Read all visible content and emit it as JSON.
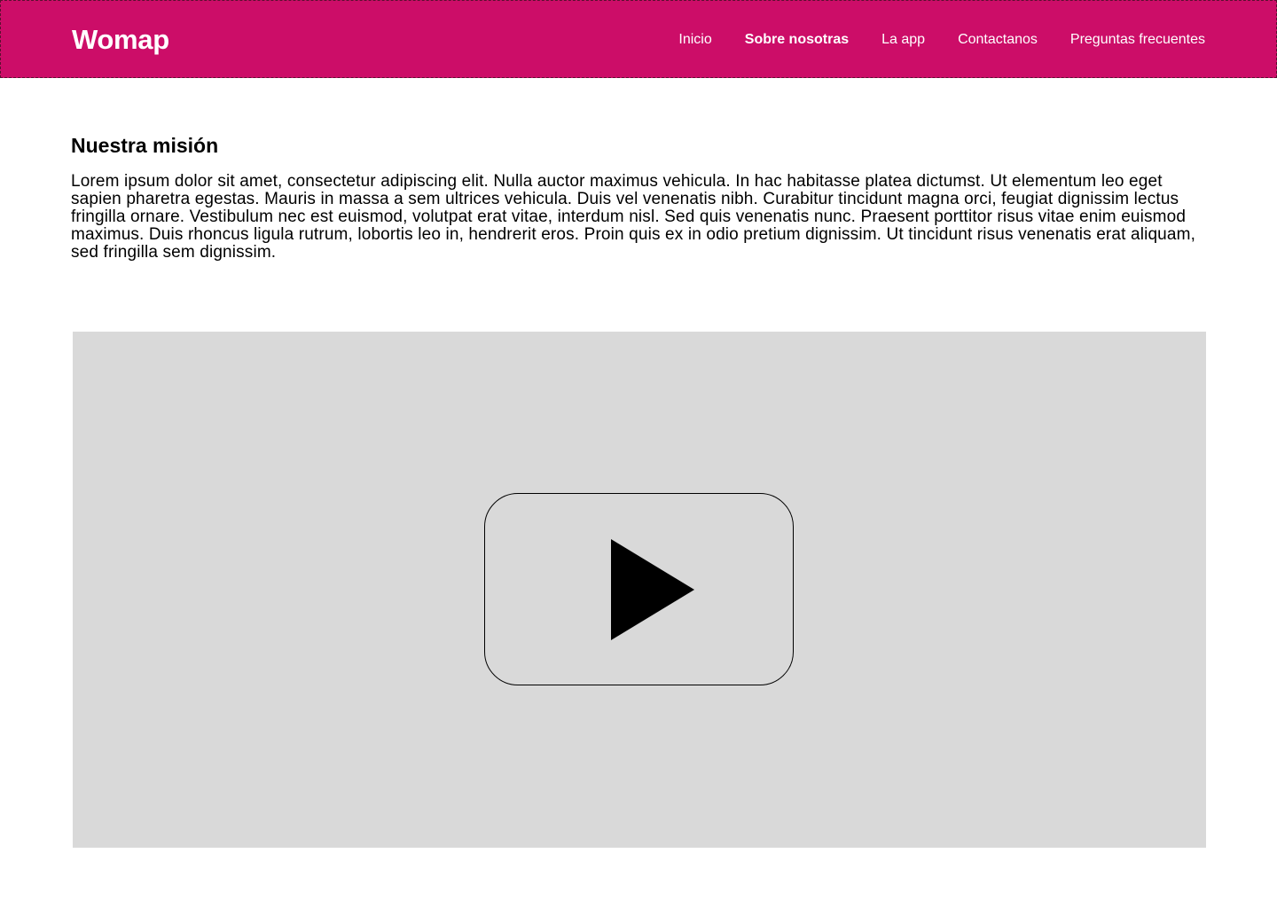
{
  "header": {
    "logo": "Womap",
    "background_color": "#cc0d68",
    "nav": [
      {
        "label": "Inicio",
        "active": false
      },
      {
        "label": "Sobre nosotras",
        "active": true
      },
      {
        "label": "La app",
        "active": false
      },
      {
        "label": "Contactanos",
        "active": false
      },
      {
        "label": "Preguntas frecuentes",
        "active": false
      }
    ]
  },
  "main": {
    "mission_title": "Nuestra misión",
    "mission_text": "Lorem ipsum dolor sit amet, consectetur adipiscing elit. Nulla auctor maximus vehicula. In hac habitasse platea dictumst. Ut elementum leo eget sapien pharetra egestas. Mauris in massa a sem ultrices vehicula. Duis vel venenatis nibh. Curabitur tincidunt magna orci, feugiat dignissim lectus fringilla ornare. Vestibulum nec est euismod, volutpat erat vitae, interdum nisl. Sed quis venenatis nunc. Praesent porttitor risus vitae enim euismod maximus. Duis rhoncus ligula rutrum, lobortis leo in, hendrerit eros. Proin quis ex in odio pretium dignissim. Ut tincidunt risus venenatis erat aliquam, sed fringilla sem dignissim.",
    "video": {
      "placeholder_color": "#d9d9d9",
      "icon": "play-icon"
    }
  }
}
